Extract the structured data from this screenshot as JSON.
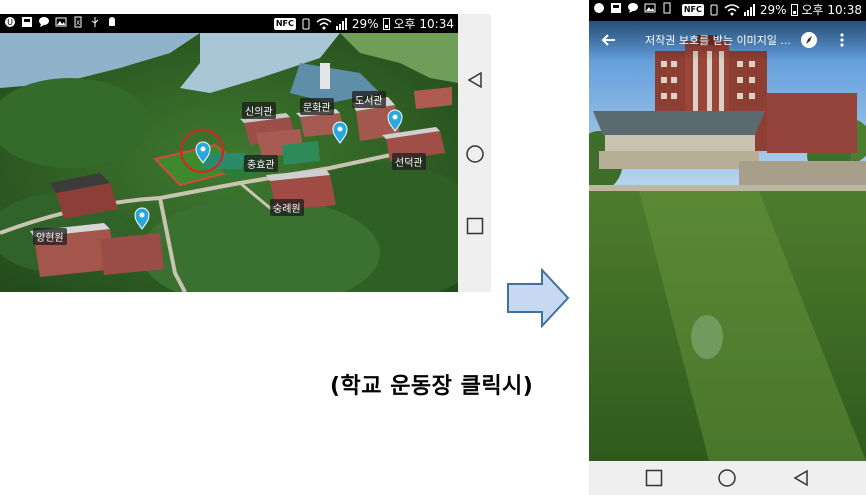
{
  "left_phone": {
    "status_bar": {
      "battery_percent": "29%",
      "nfc_label": "NFC",
      "time": "오후 10:34",
      "icons": [
        "app-icon",
        "notification-icon",
        "chat-icon",
        "image-icon",
        "file-icon",
        "usb-icon",
        "android-icon",
        "phone-vibrate-icon",
        "wifi-icon",
        "signal-icon",
        "battery-icon"
      ]
    },
    "map": {
      "buildings": {
        "sinui": "신의관",
        "munhwa": "문화관",
        "doseo": "도서관",
        "chunghyo": "충효관",
        "seondeok": "선덕관",
        "sungrye": "숭례원",
        "yanghyeon": "양현원"
      },
      "highlight_color": "#e02020",
      "pin_color": "#29a8e0"
    },
    "nav_icons": [
      "back-icon",
      "home-icon",
      "recents-icon"
    ]
  },
  "caption": "(학교 운동장 클릭시)",
  "right_phone": {
    "status_bar": {
      "battery_percent": "29%",
      "nfc_label": "NFC",
      "time": "오후 10:38",
      "icons": [
        "app-icon",
        "notification-icon",
        "chat-icon",
        "image-icon",
        "file-icon",
        "phone-vibrate-icon",
        "wifi-icon",
        "signal-icon",
        "battery-icon"
      ]
    },
    "toolbar": {
      "title": "저작권 보호를 받는 이미지일 ...",
      "icons": [
        "back-arrow-icon",
        "compass-icon",
        "more-vertical-icon"
      ]
    },
    "nav_icons": [
      "recents-icon",
      "home-icon",
      "back-icon"
    ]
  },
  "colors": {
    "arrow_fill": "#c6d9f1",
    "arrow_stroke": "#41719c",
    "navbar_bg": "#efefef"
  }
}
